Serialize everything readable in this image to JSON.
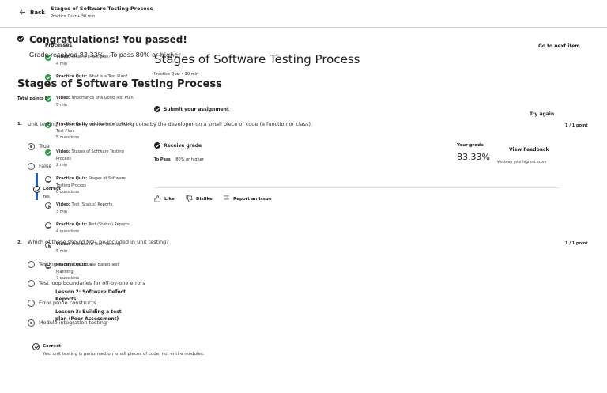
{
  "header": {
    "back_label": "Back",
    "title": "Stages of Software Testing Process",
    "subtitle": "Practice Quiz • 30 min"
  },
  "banner": {
    "title": "Congratulations! You passed!",
    "grade_text": "Grade received 83.33%",
    "pass_text": "To pass 80% or higher",
    "go_next": "Go to next item"
  },
  "sidebar": {
    "top_text": "Processes",
    "items": [
      {
        "kind": "done",
        "bold": "Video:",
        "text": " What is a test plan?",
        "meta": "4 min"
      },
      {
        "kind": "done",
        "bold": "Practice Quiz:",
        "text": " What is a Test Plan?",
        "meta": ""
      },
      {
        "kind": "done",
        "bold": "Video:",
        "text": " Importance of a Good Test Plan",
        "meta": "5 min"
      },
      {
        "kind": "done",
        "bold": "Practice Quiz:",
        "text": " Importance of a Good Test Plan",
        "meta": "5 questions"
      },
      {
        "kind": "done",
        "bold": "Video:",
        "text": " Stages of Software Testing Process",
        "meta": "2 min"
      },
      {
        "kind": "quiz",
        "bold": "Practice Quiz:",
        "text": " Stages of Software Testing Process",
        "meta": "6 questions"
      },
      {
        "kind": "play",
        "bold": "Video:",
        "text": " Test (Status) Reports",
        "meta": "3 min"
      },
      {
        "kind": "quiz",
        "bold": "Practice Quiz:",
        "text": " Test (Status) Reports",
        "meta": "4 questions"
      },
      {
        "kind": "play",
        "bold": "Video:",
        "text": " Risk-based Test Planning",
        "meta": "5 min"
      },
      {
        "kind": "quiz",
        "bold": "Practice Quiz:",
        "text": " Risk Based Test Planning",
        "meta": "7 questions"
      }
    ],
    "lesson2": "Lesson 2: Software Defect Reports",
    "lesson3": "Lesson 3: Building a test plan (Peer Assessment)"
  },
  "main": {
    "title": "Stages of Software Testing Process",
    "subtitle": "Practice Quiz • 30 min",
    "submit_label": "Submit your assignment",
    "try_again": "Try again",
    "receive_label": "Receive grade",
    "to_pass_label": "To Pass",
    "to_pass_value": "80% or higher",
    "your_grade_label": "Your grade",
    "your_grade_value": "83.33%",
    "view_feedback": "View Feedback",
    "keep_highest": "We keep your highest score",
    "like": "Like",
    "dislike": "Dislike",
    "report": "Report an issue"
  },
  "quiz": {
    "title": "Stages of Software Testing Process",
    "total_points": "Total points 5",
    "questions": [
      {
        "num": "1.",
        "text": "Unit testing is primarily white box testing done by the developer on a small piece of code (a function or class).",
        "points": "1 / 1 point",
        "options": [
          "True",
          "False"
        ],
        "selected": 0,
        "feedback_title": "Correct",
        "feedback_text": "Yes"
      },
      {
        "num": "2.",
        "text": "Which of these should NOT be included in unit testing?",
        "points": "1 / 1 point",
        "options": [
          "Testing array bounds",
          "Test loop boundaries for off-by-one errors",
          "Error prone constructs",
          "Module integration testing"
        ],
        "selected": 3,
        "feedback_title": "Correct",
        "feedback_text": "Yes: unit testing is performed on small pieces of code, not entire modules."
      }
    ]
  }
}
